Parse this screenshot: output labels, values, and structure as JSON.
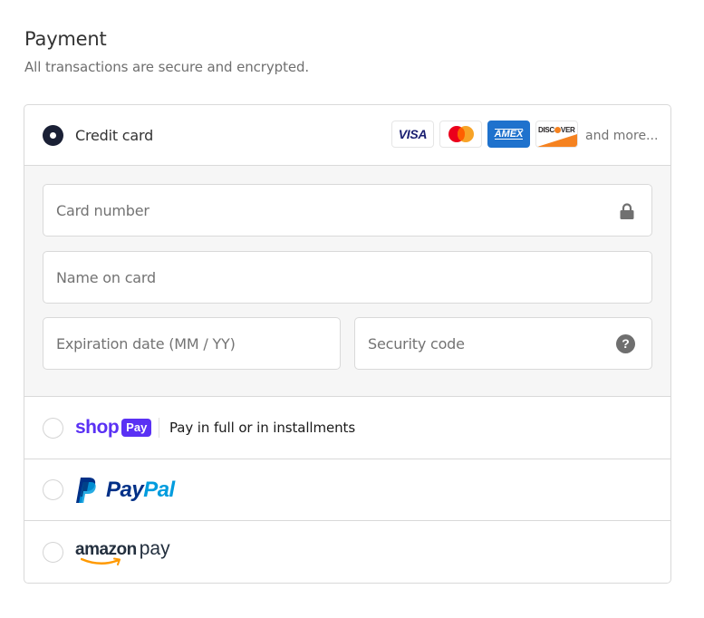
{
  "header": {
    "title": "Payment",
    "subtitle": "All transactions are secure and encrypted."
  },
  "methods": {
    "credit_card": {
      "label": "Credit card",
      "selected": true,
      "card_brands": [
        "VISA",
        "Mastercard",
        "AMEX",
        "DISCOVER"
      ],
      "visa_label": "VISA",
      "amex_label": "AMEX",
      "discover_label_left": "DISC",
      "discover_label_right": "VER",
      "and_more": "and more...",
      "fields": {
        "card_number": {
          "placeholder": "Card number",
          "value": "",
          "icon": "lock-icon"
        },
        "name_on_card": {
          "placeholder": "Name on card",
          "value": ""
        },
        "expiration": {
          "placeholder": "Expiration date (MM / YY)",
          "value": ""
        },
        "security_code": {
          "placeholder": "Security code",
          "value": "",
          "icon": "help-icon",
          "icon_glyph": "?"
        }
      }
    },
    "shop_pay": {
      "selected": false,
      "brand_word": "shop",
      "brand_badge": "Pay",
      "description": "Pay in full or in installments"
    },
    "paypal": {
      "selected": false,
      "brand_part1": "Pay",
      "brand_part2": "Pal"
    },
    "amazon_pay": {
      "selected": false,
      "brand_word": "amazon",
      "brand_suffix": "pay"
    }
  },
  "colors": {
    "selected_radio": "#1a2035",
    "shop_pay_purple": "#5a31f4",
    "paypal_dark": "#003087",
    "paypal_light": "#009cde",
    "amazon_orange": "#ff9900",
    "amex_blue": "#1f72cd"
  }
}
